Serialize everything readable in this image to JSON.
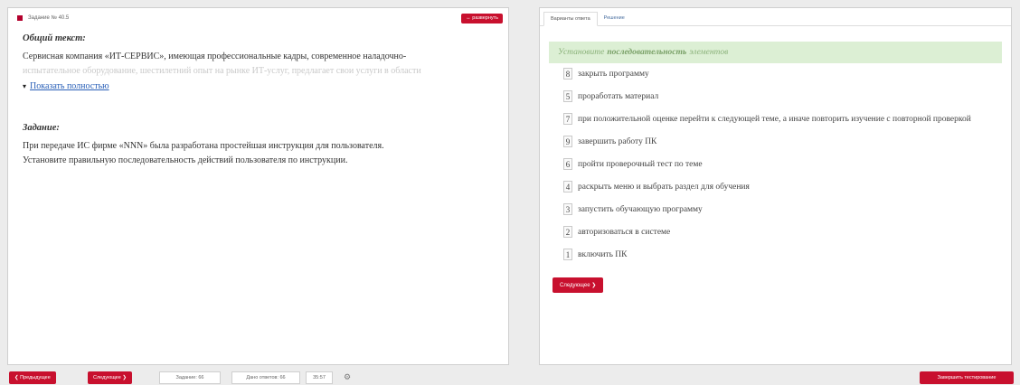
{
  "task": {
    "header_label": "Задание № 40.5",
    "expand_button": "↔ развернуть",
    "general_heading": "Общий текст:",
    "general_text_visible": "Сервисная компания «ИТ-СЕРВИС», имеющая профессиональные кадры, современное наладочно-",
    "general_text_faded": "испытательное оборудование, шестилетний опыт на рынке ИТ-услуг, предлагает свои услуги в области",
    "show_full_link": "Показать полностью",
    "task_heading": "Задание:",
    "task_line_1": "При передаче ИС фирме «NNN» была разработана простейшая инструкция для пользователя.",
    "task_line_2": "Установите правильную последовательность действий пользователя по инструкции."
  },
  "tabs": [
    {
      "label": "Варианты ответа",
      "active": true
    },
    {
      "label": "Решение",
      "active": false
    }
  ],
  "instruction": {
    "part1": "Установите",
    "part2": "последовательность",
    "part3": "элементов"
  },
  "answers": [
    {
      "num": "8",
      "text": "закрыть программу"
    },
    {
      "num": "5",
      "text": "проработать материал"
    },
    {
      "num": "7",
      "text": "при положительной оценке перейти к следующей теме, а иначе повторить изучение с повторной проверкой"
    },
    {
      "num": "9",
      "text": "завершить работу ПК"
    },
    {
      "num": "6",
      "text": "пройти проверочный тест по теме"
    },
    {
      "num": "4",
      "text": "раскрыть меню и выбрать раздел для обучения"
    },
    {
      "num": "3",
      "text": "запустить обучающую программу"
    },
    {
      "num": "2",
      "text": "авторизоваться в системе"
    },
    {
      "num": "1",
      "text": "включить ПК"
    }
  ],
  "next_button_right": "Следующее ❯",
  "bottom": {
    "prev": "❮ Предыдущее",
    "next": "Следующее ❯",
    "task_counter": "Задание: 66",
    "answers_counter": "Дано ответов: 66",
    "timer": "35:57",
    "finish": "Завершить тестирование"
  },
  "colors": {
    "accent": "#c8102e",
    "instruction_bg": "#dcefd4"
  },
  "icons": {
    "settings": "gear-icon",
    "expand_chevron": "chevron-down-icon"
  }
}
